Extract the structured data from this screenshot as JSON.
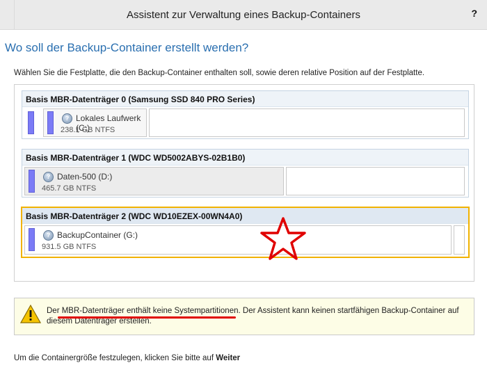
{
  "window": {
    "title": "Assistent zur Verwaltung eines Backup-Containers",
    "help_label": "?"
  },
  "heading": "Wo soll der Backup-Container erstellt werden?",
  "instruction": "Wählen Sie die Festplatte, die den Backup-Container enthalten soll, sowie deren relative Position auf der Festplatte.",
  "disks": [
    {
      "title": "Basis MBR-Datenträger 0 (Samsung SSD 840 PRO Series)",
      "partition": {
        "name": "Lokales Laufwerk (C:)",
        "size": "238.1 GB NTFS"
      },
      "selected": false
    },
    {
      "title": "Basis MBR-Datenträger 1 (WDC WD5002ABYS-02B1B0)",
      "partition": {
        "name": "Daten-500 (D:)",
        "size": "465.7 GB NTFS"
      },
      "selected": false
    },
    {
      "title": "Basis MBR-Datenträger 2 (WDC WD10EZEX-00WN4A0)",
      "partition": {
        "name": "BackupContainer (G:)",
        "size": "931.5 GB NTFS"
      },
      "selected": true
    }
  ],
  "warning": {
    "underlined_text": "Der MBR-Datenträger enthält keine Systempartitionen",
    "rest_text": ". Der Assistent kann keinen startfähigen Backup-Container auf diesem Datenträger erstellen.",
    "icon": "warning-triangle-icon"
  },
  "footer": {
    "text": "Um die Containergröße festzulegen, klicken Sie bitte auf ",
    "bold": "Weiter"
  },
  "colors": {
    "accent": "#2a6fb0",
    "selection": "#f1b200",
    "partition_bar": "#7b7bf6",
    "annotation": "#e00000"
  }
}
